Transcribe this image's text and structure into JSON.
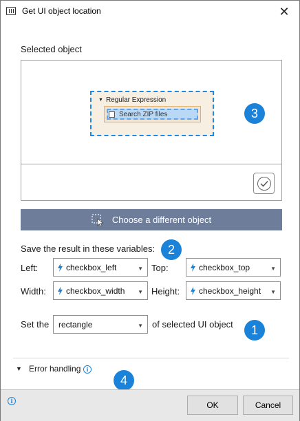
{
  "window": {
    "title": "Get UI object location",
    "close_glyph": "✕"
  },
  "preview": {
    "label": "Selected object",
    "captured_row_text": "Regular Expression",
    "captured_target_text": "Search ZIP files"
  },
  "choose_button": {
    "label": "Choose a different object"
  },
  "variables": {
    "label": "Save the result in these variables:",
    "left": {
      "label": "Left:",
      "value": "checkbox_left"
    },
    "top": {
      "label": "Top:",
      "value": "checkbox_top"
    },
    "width": {
      "label": "Width:",
      "value": "checkbox_width"
    },
    "height": {
      "label": "Height:",
      "value": "checkbox_height"
    }
  },
  "set_the": {
    "prefix": "Set the",
    "value": "rectangle",
    "suffix": "of selected UI object"
  },
  "error_handling": {
    "label": "Error handling"
  },
  "badges": [
    "1",
    "2",
    "3",
    "4"
  ],
  "footer": {
    "ok_label": "OK",
    "cancel_label": "Cancel"
  },
  "colors": {
    "accent": "#1a82d8",
    "choose_button_bg": "#6e7d99",
    "highlight_dash": "#1e88e5",
    "footer_bg": "#e8e8e8"
  },
  "icons": [
    "app-icon",
    "close-icon",
    "verify-icon",
    "select-cursor-icon",
    "variable-bolt-icon",
    "chevron-down-icon",
    "info-icon"
  ]
}
